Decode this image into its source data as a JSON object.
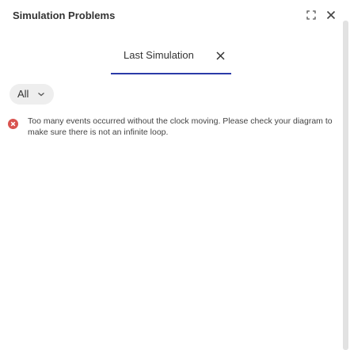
{
  "header": {
    "title": "Simulation Problems"
  },
  "tabs": [
    {
      "label": "Last Simulation"
    }
  ],
  "filter": {
    "selected": "All"
  },
  "problems": [
    {
      "severity": "error",
      "message": "Too many events occurred without the clock moving. Please check your diagram to make sure there is not an infinite loop."
    }
  ],
  "colors": {
    "accent": "#2b3aa8",
    "error": "#d9534f",
    "text": "#333333",
    "filter_bg": "#eeeeee"
  },
  "icons": {
    "expand": "expand-icon",
    "close": "close-icon",
    "tab_close": "close-icon",
    "filter": "chevron-down-icon",
    "severity": "error-icon"
  }
}
